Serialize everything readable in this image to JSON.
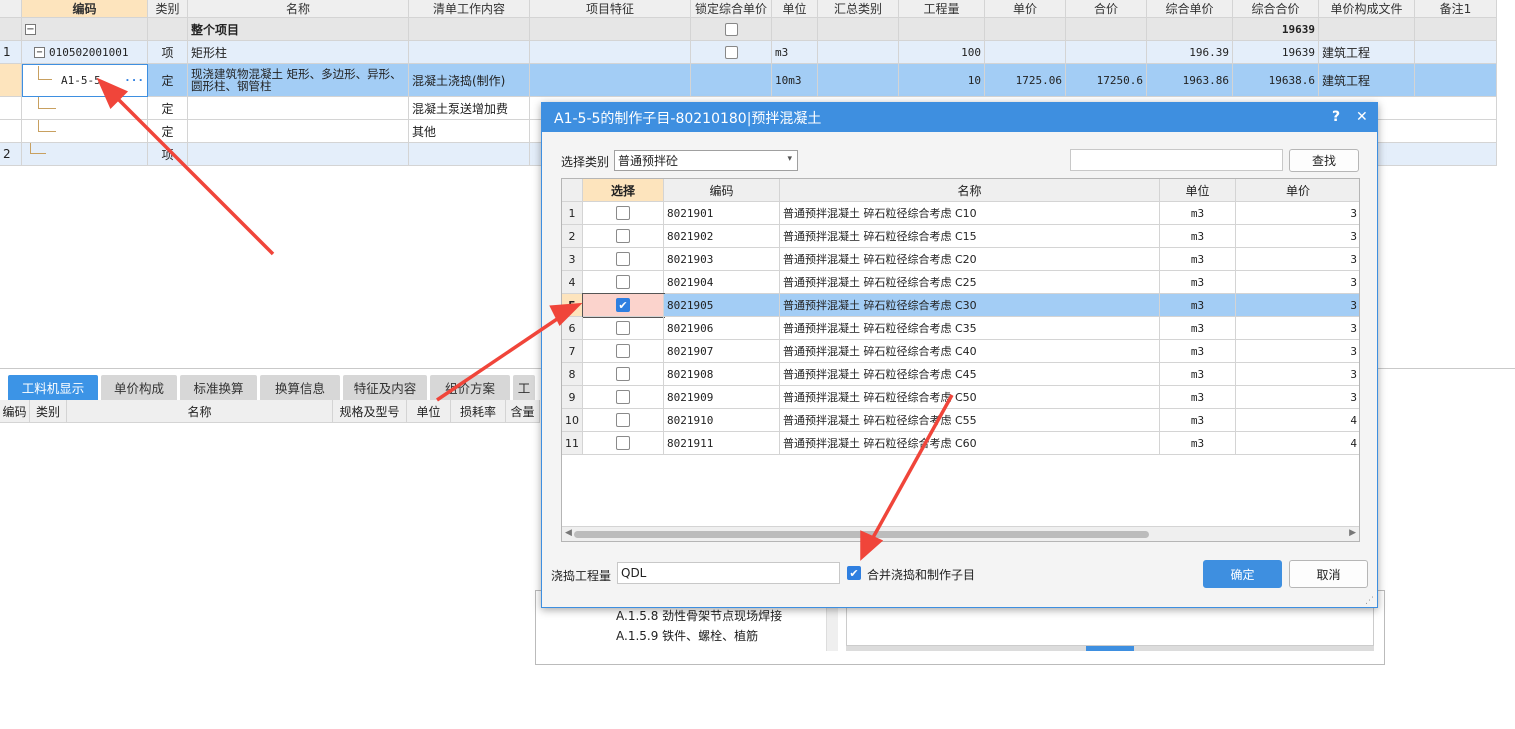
{
  "grid": {
    "headers": [
      "",
      "编码",
      "类别",
      "名称",
      "清单工作内容",
      "项目特征",
      "锁定综合单价",
      "单位",
      "汇总类别",
      "工程量",
      "单价",
      "合价",
      "综合单价",
      "综合合价",
      "单价构成文件",
      "备注1"
    ],
    "rows": [
      {
        "no": "",
        "code": "",
        "type": "",
        "name": "整个项目",
        "content": "",
        "feature": "",
        "unit": "",
        "sumcat": "",
        "qty": "",
        "price": "",
        "total": "",
        "uprice": "",
        "utotal": "19639",
        "file": ""
      },
      {
        "no": "1",
        "code": "010502001001",
        "type": "项",
        "name": "矩形柱",
        "content": "",
        "feature": "",
        "unit": "m3",
        "sumcat": "",
        "qty": "100",
        "price": "",
        "total": "",
        "uprice": "196.39",
        "utotal": "19639",
        "file": "建筑工程"
      },
      {
        "no": "",
        "code": "A1-5-5",
        "type": "定",
        "name": "现浇建筑物混凝土 矩形、多边形、异形、圆形柱、钢管柱",
        "content": "混凝土浇捣(制作)",
        "feature": "",
        "unit": "10m3",
        "sumcat": "",
        "qty": "10",
        "price": "1725.06",
        "total": "17250.6",
        "uprice": "1963.86",
        "utotal": "19638.6",
        "file": "建筑工程"
      },
      {
        "no": "",
        "code": "",
        "type": "定",
        "name": "",
        "content": "混凝土泵送增加费",
        "feature": "",
        "unit": "",
        "sumcat": "",
        "qty": "",
        "price": "",
        "total": "",
        "uprice": "",
        "utotal": "",
        "file": ""
      },
      {
        "no": "",
        "code": "",
        "type": "定",
        "name": "",
        "content": "其他",
        "feature": "",
        "unit": "",
        "sumcat": "",
        "qty": "",
        "price": "",
        "total": "",
        "uprice": "",
        "utotal": "",
        "file": ""
      },
      {
        "no": "2",
        "code": "",
        "type": "项",
        "name": "",
        "content": "",
        "feature": "",
        "unit": "",
        "sumcat": "",
        "qty": "",
        "price": "",
        "total": "",
        "uprice": "",
        "utotal": "",
        "file": ""
      }
    ],
    "more_icon": "···"
  },
  "tabs": [
    "工料机显示",
    "单价构成",
    "标准换算",
    "换算信息",
    "特征及内容",
    "组价方案",
    "工"
  ],
  "subheaders": [
    "编码",
    "类别",
    "名称",
    "规格及型号",
    "单位",
    "损耗率",
    "含量"
  ],
  "behind_tree": [
    "A.1.5.8 劲性骨架节点现场焊接",
    "A.1.5.9 铁件、螺栓、植筋"
  ],
  "dialog": {
    "title": "A1-5-5的制作子目-80210180|预拌混凝土",
    "help": "?",
    "close": "✕",
    "category_label": "选择类别",
    "category_value": "普通预拌砼",
    "search_value": "",
    "search_button": "查找",
    "table_headers": [
      "",
      "选择",
      "编码",
      "名称",
      "单位",
      "单价"
    ],
    "rows": [
      {
        "no": "1",
        "checked": false,
        "code": "8021901",
        "name": "普通预拌混凝土 碎石粒径综合考虑 C10",
        "unit": "m3",
        "price": "3"
      },
      {
        "no": "2",
        "checked": false,
        "code": "8021902",
        "name": "普通预拌混凝土 碎石粒径综合考虑 C15",
        "unit": "m3",
        "price": "3"
      },
      {
        "no": "3",
        "checked": false,
        "code": "8021903",
        "name": "普通预拌混凝土 碎石粒径综合考虑 C20",
        "unit": "m3",
        "price": "3"
      },
      {
        "no": "4",
        "checked": false,
        "code": "8021904",
        "name": "普通预拌混凝土 碎石粒径综合考虑 C25",
        "unit": "m3",
        "price": "3"
      },
      {
        "no": "5",
        "checked": true,
        "code": "8021905",
        "name": "普通预拌混凝土 碎石粒径综合考虑 C30",
        "unit": "m3",
        "price": "3"
      },
      {
        "no": "6",
        "checked": false,
        "code": "8021906",
        "name": "普通预拌混凝土 碎石粒径综合考虑 C35",
        "unit": "m3",
        "price": "3"
      },
      {
        "no": "7",
        "checked": false,
        "code": "8021907",
        "name": "普通预拌混凝土 碎石粒径综合考虑 C40",
        "unit": "m3",
        "price": "3"
      },
      {
        "no": "8",
        "checked": false,
        "code": "8021908",
        "name": "普通预拌混凝土 碎石粒径综合考虑 C45",
        "unit": "m3",
        "price": "3"
      },
      {
        "no": "9",
        "checked": false,
        "code": "8021909",
        "name": "普通预拌混凝土 碎石粒径综合考虑 C50",
        "unit": "m3",
        "price": "3"
      },
      {
        "no": "10",
        "checked": false,
        "code": "8021910",
        "name": "普通预拌混凝土 碎石粒径综合考虑 C55",
        "unit": "m3",
        "price": "4"
      },
      {
        "no": "11",
        "checked": false,
        "code": "8021911",
        "name": "普通预拌混凝土 碎石粒径综合考虑 C60",
        "unit": "m3",
        "price": "4"
      }
    ],
    "qty_label": "浇捣工程量",
    "qty_value": "QDL",
    "merge_label": "合并浇捣和制作子目",
    "merge_checked": true,
    "ok_button": "确定",
    "cancel_button": "取消"
  },
  "colors": {
    "accent": "#3e8fe0",
    "selected_row": "#a3cdf5",
    "active_header": "#fde4bd",
    "annotation_arrow": "#f0453a"
  }
}
